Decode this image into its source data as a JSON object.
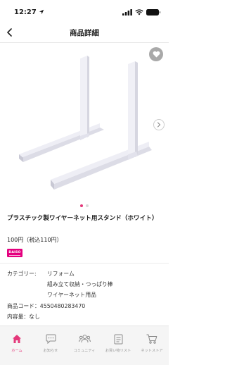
{
  "status_bar": {
    "time": "12:27",
    "location_icon": "location-arrow-icon",
    "signal_icon": "cellular-signal-icon",
    "wifi_icon": "wifi-icon",
    "battery_icon": "battery-icon"
  },
  "nav": {
    "title": "商品詳細",
    "back_icon": "chevron-left-icon"
  },
  "product": {
    "title": "プラスチック製ワイヤーネット用スタンド（ホワイト）",
    "price": "100円（税込110円）",
    "brand_logo": "DAISO",
    "category_label": "カテゴリー:",
    "categories": [
      "リフォーム",
      "組み立て収納・つっぱり棒",
      "ワイヤーネット用品"
    ],
    "code_row": "商品コード：4550480283470",
    "capacity_row": "内容量：なし"
  },
  "carousel": {
    "total": 2,
    "active_index": 0,
    "favorite_icon": "heart-icon",
    "next_icon": "chevron-right-icon"
  },
  "tabbar": {
    "accent": "#e4387a",
    "items": [
      {
        "label": "ホーム",
        "icon": "home-icon"
      },
      {
        "label": "お知らせ",
        "icon": "chat-bubble-icon"
      },
      {
        "label": "コミュニティ",
        "icon": "people-icon"
      },
      {
        "label": "お買い物リスト",
        "icon": "checklist-icon"
      },
      {
        "label": "ネットストア",
        "icon": "cart-icon"
      }
    ]
  }
}
